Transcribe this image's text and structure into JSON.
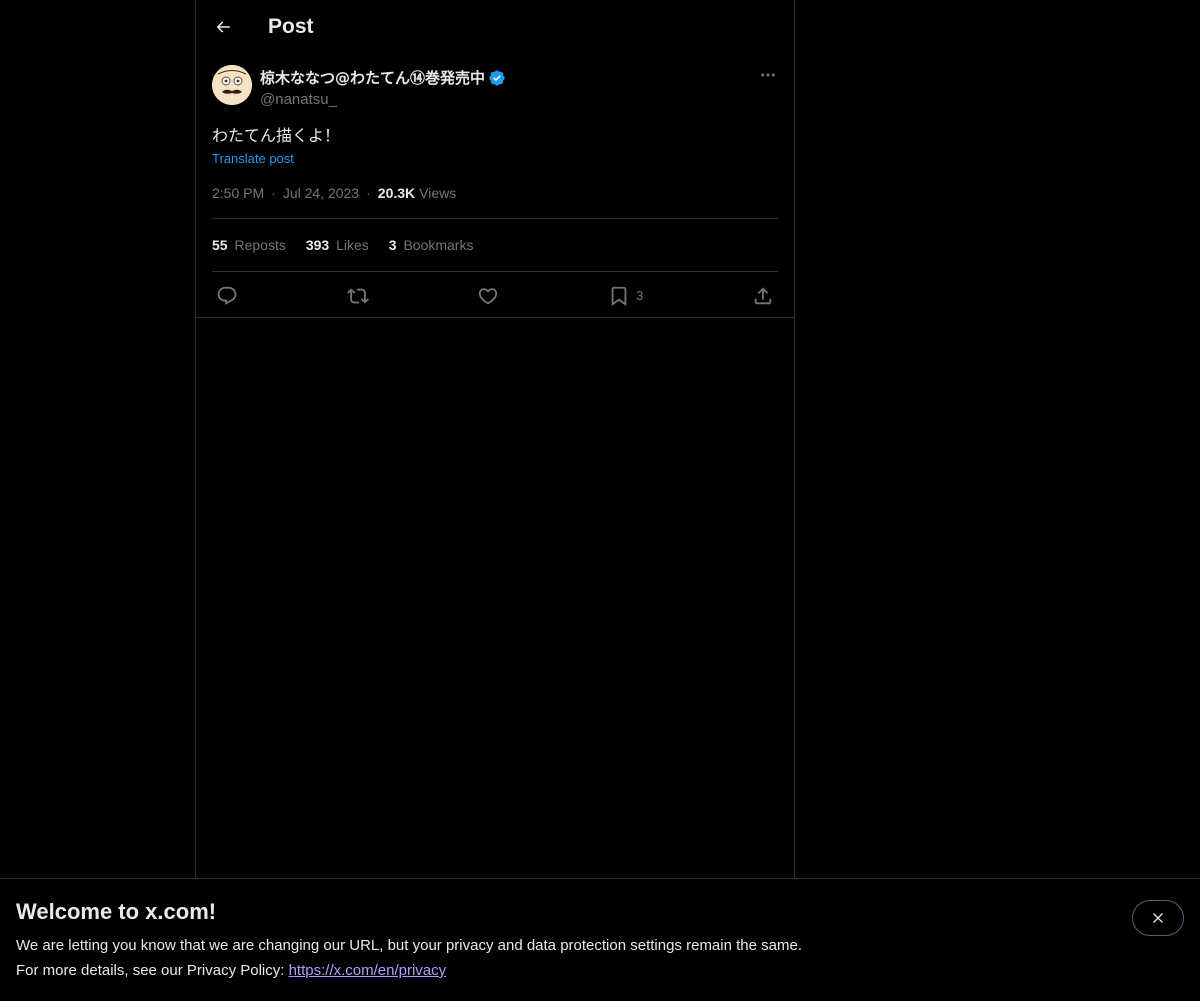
{
  "header": {
    "title": "Post",
    "back_icon": "arrow-left-icon"
  },
  "post": {
    "author": {
      "display_name": "椋木ななつ@わたてん⑭巻発売中",
      "handle": "@nanatsu_",
      "verified": true,
      "verified_color": "#1d9bf0"
    },
    "text": "わたてん描くよ！",
    "translate_label": "Translate post",
    "time": "2:50 PM",
    "date": "Jul 24, 2023",
    "views_count": "20.3K",
    "views_label": "Views",
    "stats": {
      "reposts_count": "55",
      "reposts_label": "Reposts",
      "likes_count": "393",
      "likes_label": "Likes",
      "bookmarks_count": "3",
      "bookmarks_label": "Bookmarks"
    },
    "actions": {
      "reply_icon": "reply-icon",
      "repost_icon": "repost-icon",
      "like_icon": "heart-icon",
      "bookmark_icon": "bookmark-icon",
      "bookmark_count": "3",
      "share_icon": "share-icon"
    }
  },
  "banner": {
    "title": "Welcome to x.com!",
    "line1": "We are letting you know that we are changing our URL, but your privacy and data protection settings remain the same.",
    "line2_prefix": "For more details, see our Privacy Policy: ",
    "link_text": "https://x.com/en/privacy",
    "close_icon": "close-icon"
  },
  "colors": {
    "background": "#000000",
    "text_primary": "#e7e9ea",
    "text_secondary": "#71767b",
    "accent": "#1d9bf0",
    "border": "#2f3336",
    "link": "#a9a0ff"
  }
}
